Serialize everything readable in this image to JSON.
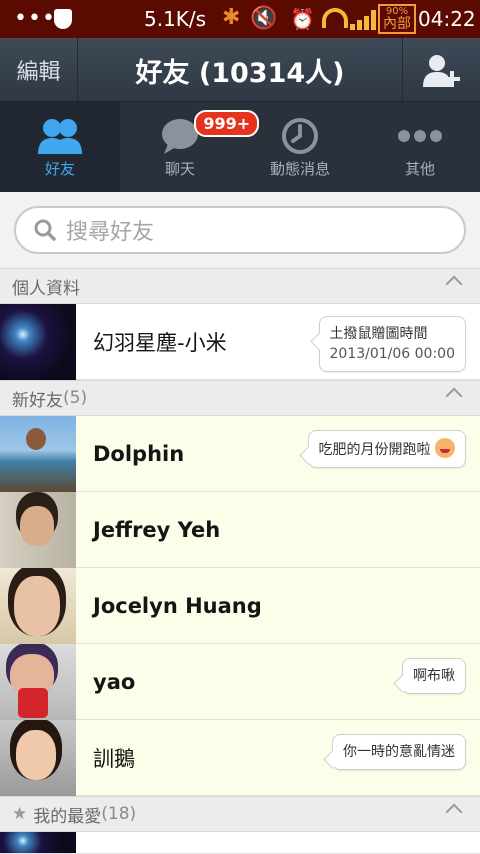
{
  "status_bar": {
    "dots": "•••",
    "net_speed": "5.1K/s",
    "battery_pct": "90%",
    "battery_label": "內部",
    "time": "04:22"
  },
  "header": {
    "edit_label": "編輯",
    "title": "好友 (10314人)"
  },
  "tabs": [
    {
      "label": "好友",
      "icon": "friends-icon",
      "active": true
    },
    {
      "label": "聊天",
      "icon": "chat-icon",
      "badge": "999+"
    },
    {
      "label": "動態消息",
      "icon": "clock-icon"
    },
    {
      "label": "其他",
      "icon": "more-icon"
    }
  ],
  "search": {
    "placeholder": "搜尋好友"
  },
  "sections": {
    "profile": {
      "label": "個人資料"
    },
    "new_friends": {
      "label": "新好友",
      "count": "(5)"
    },
    "favorites": {
      "label": "我的最愛",
      "count": "(18)"
    }
  },
  "profile": {
    "name": "幻羽星塵-小米",
    "status_line1": "土撥鼠贈圖時間",
    "status_line2": "2013/01/06 00:00"
  },
  "friends": [
    {
      "name": "Dolphin",
      "status": "吃肥的月份開跑啦",
      "emoji": "laughing-face-icon"
    },
    {
      "name": "Jeffrey Yeh",
      "status": ""
    },
    {
      "name": "Jocelyn Huang",
      "status": ""
    },
    {
      "name": "yao",
      "status": "啊布啾"
    },
    {
      "name": "訓鵝",
      "status": "你一時的意亂情迷"
    }
  ],
  "colors": {
    "status_bar_bg": "#5a0a00",
    "header_bg": "#3a4450",
    "tab_active": "#41a6f0",
    "badge_red": "#e5331d",
    "new_friend_row_bg": "#fdfee9"
  }
}
